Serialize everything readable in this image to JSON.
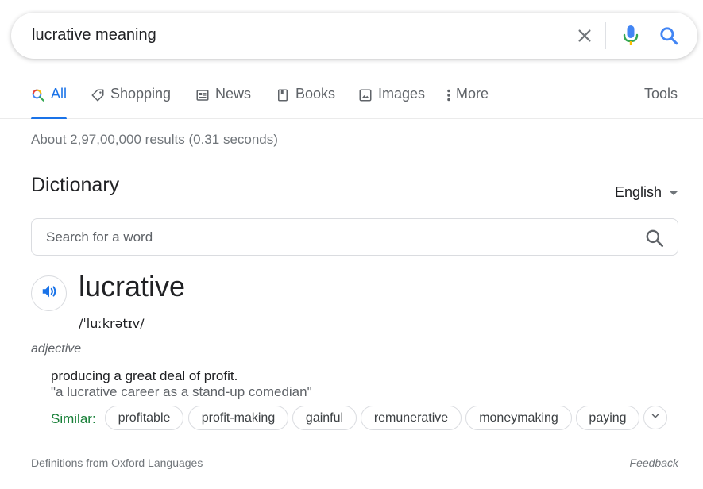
{
  "search": {
    "query": "lucrative meaning",
    "clear_icon": "close-icon",
    "voice_icon": "mic-icon",
    "search_icon": "search-icon"
  },
  "tabs": [
    {
      "label": "All",
      "icon": "search-icon",
      "active": true
    },
    {
      "label": "Shopping",
      "icon": "tag-icon"
    },
    {
      "label": "News",
      "icon": "news-icon"
    },
    {
      "label": "Books",
      "icon": "book-icon"
    },
    {
      "label": "Images",
      "icon": "image-icon"
    },
    {
      "label": "More",
      "icon": "more-vert-icon"
    }
  ],
  "tools_label": "Tools",
  "results_stats": "About 2,97,00,000 results (0.31 seconds)",
  "dictionary": {
    "title": "Dictionary",
    "language": "English",
    "search_placeholder": "Search for a word",
    "word": "lucrative",
    "phonetic": "/ˈluːkrətɪv/",
    "part_of_speech": "adjective",
    "definition": "producing a great deal of profit.",
    "example": "\"a lucrative career as a stand-up comedian\"",
    "similar_label": "Similar:",
    "similar": [
      "profitable",
      "profit-making",
      "gainful",
      "remunerative",
      "moneymaking",
      "paying"
    ],
    "source": "Definitions from Oxford Languages",
    "feedback": "Feedback"
  },
  "colors": {
    "accent": "#1a73e8",
    "similar_label": "#188038",
    "mic_blue": "#4285f4",
    "mic_red": "#ea4335"
  }
}
